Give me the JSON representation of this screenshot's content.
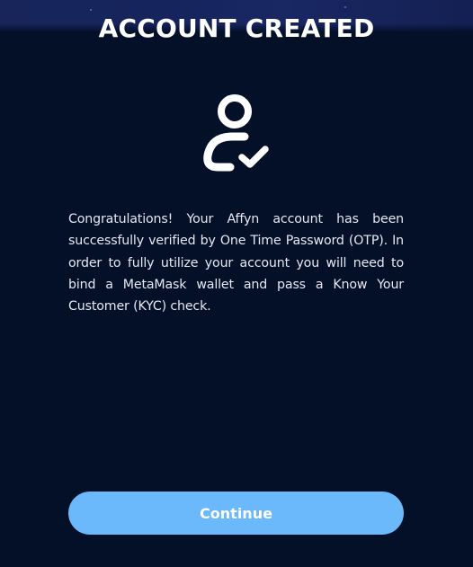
{
  "dialog": {
    "title": "ACCOUNT CREATED",
    "icon": "user-check-icon",
    "message": "Congratulations! Your Affyn account has been successfully verified by One Time Password (OTP). In order to fully utilize your account you will need to bind a MetaMask wallet and pass a Know Your Customer (KYC) check.",
    "continue_label": "Continue"
  },
  "colors": {
    "background": "#040f28",
    "header_band": "#1b2a63",
    "text": "#ffffff",
    "body_text": "#e6e9f2",
    "button": "#6bb8fb"
  }
}
